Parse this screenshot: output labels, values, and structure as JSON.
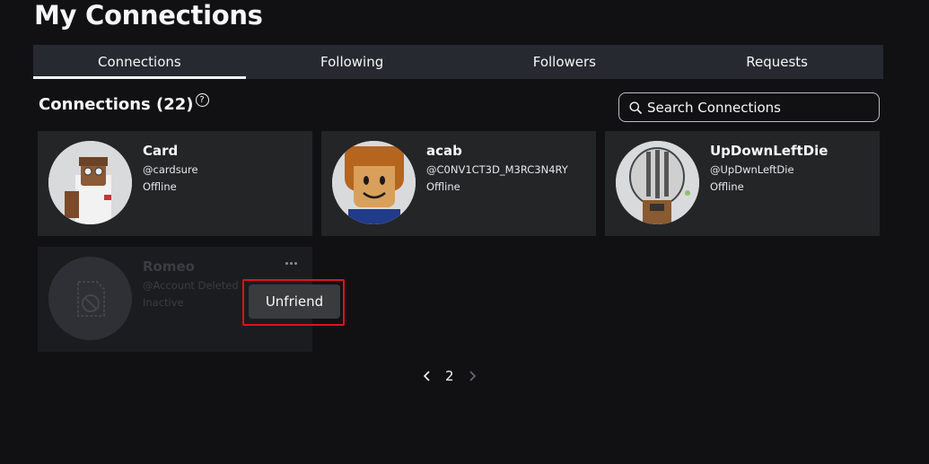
{
  "page": {
    "title": "My Connections"
  },
  "tabs": [
    {
      "label": "Connections",
      "active": true
    },
    {
      "label": "Following",
      "active": false
    },
    {
      "label": "Followers",
      "active": false
    },
    {
      "label": "Requests",
      "active": false
    }
  ],
  "section": {
    "title": "Connections (22)",
    "help_icon": "question-circle-icon"
  },
  "search": {
    "placeholder": "Search Connections",
    "value": "",
    "icon": "search-icon"
  },
  "connections": [
    {
      "name": "Card",
      "handle": "@cardsure",
      "status": "Offline"
    },
    {
      "name": "acab",
      "handle": "@C0NV1CT3D_M3RC3N4RY",
      "status": "Offline"
    },
    {
      "name": "UpDownLeftDie",
      "handle": "@UpDwnLeftDie",
      "status": "Offline"
    },
    {
      "name": "Romeo",
      "handle": "@Account Deleted",
      "status": "Inactive"
    }
  ],
  "context_menu": {
    "unfriend_label": "Unfriend"
  },
  "pagination": {
    "current_page": "2"
  },
  "colors": {
    "background": "#111114",
    "card": "#232527",
    "tab_bar": "#272930",
    "highlight": "#e0121b"
  }
}
